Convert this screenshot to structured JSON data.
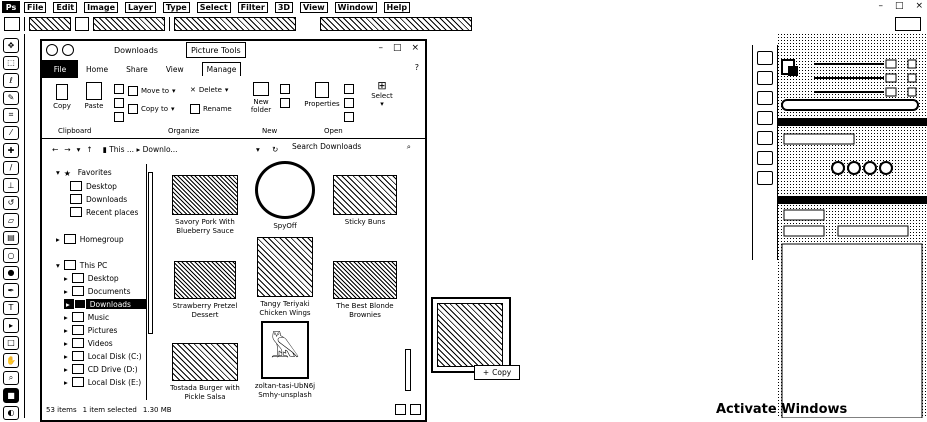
{
  "app": {
    "logo": "Ps",
    "menu": [
      "File",
      "Edit",
      "Image",
      "Layer",
      "Type",
      "Select",
      "Filter",
      "3D",
      "View",
      "Window",
      "Help"
    ],
    "window_controls": [
      "–",
      "□",
      "×"
    ]
  },
  "tools": [
    "move",
    "marquee",
    "lasso",
    "quick-select",
    "crop",
    "eyedropper",
    "heal",
    "brush",
    "stamp",
    "history",
    "eraser",
    "gradient",
    "blur",
    "dodge",
    "pen",
    "type",
    "path",
    "shape",
    "hand",
    "zoom",
    "colors",
    "mask"
  ],
  "explorer": {
    "title": "Downloads",
    "context_tab": "Picture Tools",
    "tabs": [
      "File",
      "Home",
      "Share",
      "View",
      "Manage"
    ],
    "ribbon": {
      "copy": "Copy",
      "paste": "Paste",
      "move_to": "Move to",
      "delete": "Delete",
      "copy_to": "Copy to",
      "rename": "Rename",
      "new_folder": "New folder",
      "properties": "Properties",
      "select": "Select",
      "groups": [
        "Clipboard",
        "Organize",
        "New",
        "Open"
      ]
    },
    "address": {
      "path": [
        "This ...",
        "Downlo..."
      ],
      "search_placeholder": "Search Downloads"
    },
    "nav": {
      "favorites": "Favorites",
      "desktop": "Desktop",
      "downloads": "Downloads",
      "recent": "Recent places",
      "homegroup": "Homegroup",
      "thispc": "This PC",
      "pc_desktop": "Desktop",
      "documents": "Documents",
      "pc_downloads": "Downloads",
      "music": "Music",
      "pictures": "Pictures",
      "videos": "Videos",
      "local_c": "Local Disk (C:)",
      "cd_d": "CD Drive (D:)",
      "local_e": "Local Disk (E:)"
    },
    "files": [
      {
        "name": "Savory Pork With Blueberry Sauce"
      },
      {
        "name": "SpyOff"
      },
      {
        "name": "Sticky Buns"
      },
      {
        "name": "Strawberry Pretzel Dessert"
      },
      {
        "name": "Tangy Teriyaki Chicken Wings"
      },
      {
        "name": "The Best Blonde Brownies"
      },
      {
        "name": "Tostada Burger with Pickle Salsa"
      },
      {
        "name": "zoltan-tasi-UbN6j Smhy-unsplash"
      }
    ],
    "status": {
      "count": "53 items",
      "selected": "1 item selected",
      "size": "1.30 MB"
    }
  },
  "drag": {
    "label": "Copy",
    "symbol": "+"
  },
  "watermark": "Activate Windows"
}
